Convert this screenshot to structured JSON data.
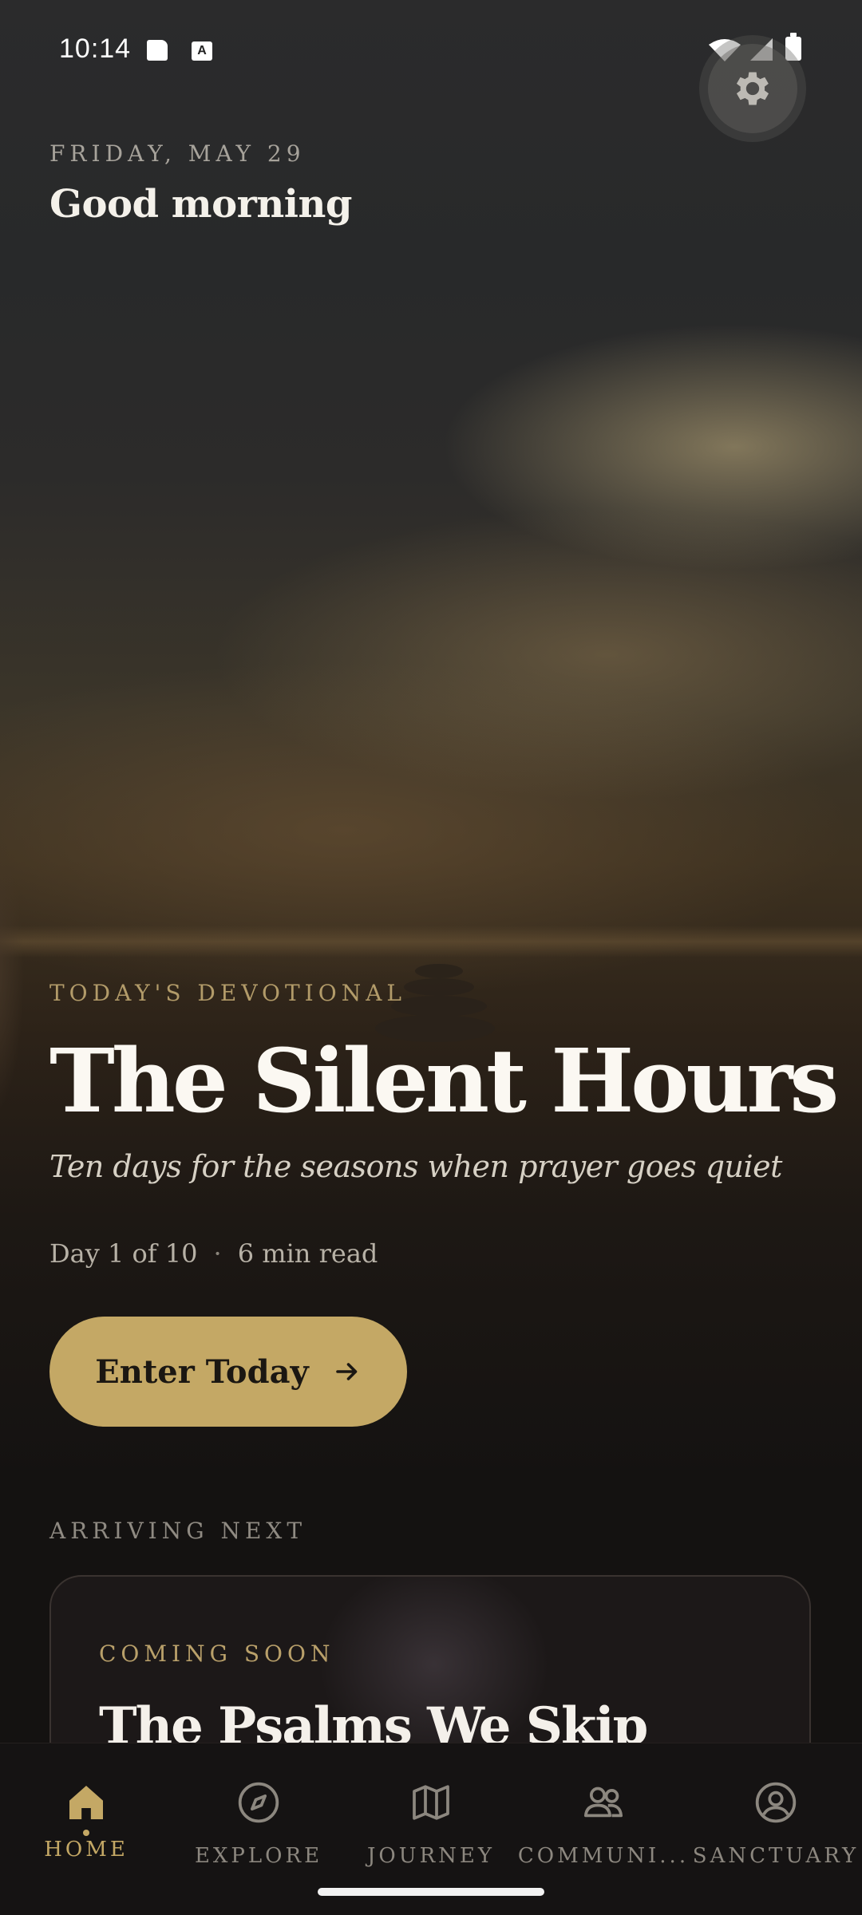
{
  "status_bar": {
    "time": "10:14",
    "sd_icon": "sd-card-icon",
    "a_icon": "A"
  },
  "header": {
    "date": "FRIDAY, MAY 29",
    "greeting": "Good morning",
    "settings_icon": "gear-icon"
  },
  "devotional": {
    "eyebrow": "TODAY'S DEVOTIONAL",
    "title": "The Silent Hours",
    "subtitle": "Ten days for the seasons when prayer goes quiet",
    "day": "Day 1 of 10",
    "separator": "·",
    "read_time": "6 min read",
    "cta_label": "Enter Today",
    "cta_icon": "arrow-right-icon"
  },
  "arriving": {
    "label": "ARRIVING NEXT",
    "card_eyebrow": "COMING SOON",
    "card_title": "The Psalms We Skip"
  },
  "nav": {
    "items": [
      {
        "label": "HOME",
        "icon": "home-icon",
        "active": true
      },
      {
        "label": "EXPLORE",
        "icon": "compass-icon",
        "active": false
      },
      {
        "label": "JOURNEY",
        "icon": "map-icon",
        "active": false
      },
      {
        "label": "COMMUNI...",
        "icon": "people-icon",
        "active": false
      },
      {
        "label": "SANCTUARY",
        "icon": "profile-icon",
        "active": false
      }
    ]
  },
  "colors": {
    "accent": "#c4a865",
    "background": "#141211",
    "muted": "#8c877f"
  }
}
